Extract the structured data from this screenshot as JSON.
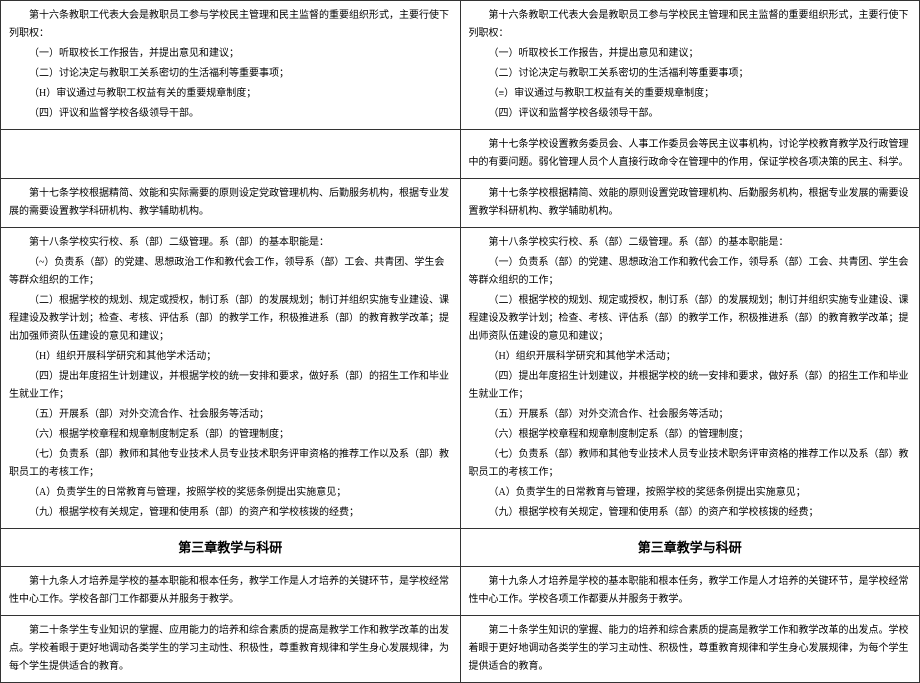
{
  "left": {
    "r1": {
      "p1": "第十六条教职工代表大会是教职员工参与学校民主管理和民主监督的重要组织形式，主要行使下列职权：",
      "p2": "（一）听取校长工作报告，并提出意见和建议；",
      "p3": "（二）讨论决定与教职工关系密切的生活福利等重要事项；",
      "p4": "（H）审议通过与教职工权益有关的重要规章制度；",
      "p5": "（四）评议和监督学校各级领导干部。"
    },
    "r2": "",
    "r3": {
      "p1": "第十七条学校根据精简、效能和实际需要的原则设定党政管理机构、后勤服务机构，根据专业发展的需要设置教学科研机构、教学辅助机构。"
    },
    "r4": {
      "p1": "第十八条学校实行校、系（部）二级管理。系（部）的基本职能是：",
      "p2": "（~）负责系（部）的党建、思想政治工作和教代会工作，领导系（部）工会、共青团、学生会等群众组织的工作；",
      "p3": "（二）根据学校的规划、规定或授权，制订系（部）的发展规划；制订并组织实施专业建设、课程建设及教学计划；检查、考核、评估系（部）的教学工作，积极推进系（部）的教育教学改革；提出加强师资队伍建设的意见和建议；",
      "p4": "（H）组织开展科学研究和其他学术活动；",
      "p5": "（四）提出年度招生计划建议，并根据学校的统一安排和要求，做好系（部）的招生工作和毕业生就业工作；",
      "p6": "（五）开展系（部）对外交流合作、社会服务等活动；",
      "p7": "（六）根据学校章程和规章制度制定系（部）的管理制度；",
      "p8": "（七）负责系（部）教师和其他专业技术人员专业技术职务评审资格的推荐工作以及系（部）教职员工的考核工作；",
      "p9": "（A）负责学生的日常教育与管理，按照学校的奖惩条例提出实施意见；",
      "p10": "（九）根据学校有关规定，管理和使用系（部）的资产和学校核拨的经费；"
    },
    "r5_heading": "第三章教学与科研",
    "r6": {
      "p1": "第十九条人才培养是学校的基本职能和根本任务，教学工作是人才培养的关键环节，是学校经常性中心工作。学校各部门工作都要从并服务于教学。"
    },
    "r7": {
      "p1": "第二十条学生专业知识的掌握、应用能力的培养和综合素质的提高是教学工作和教学改革的出发点。学校着眼于更好地调动各类学生的学习主动性、积极性，尊重教育规律和学生身心发展规律，为每个学生提供适合的教育。"
    }
  },
  "right": {
    "r1": {
      "p1": "第十六条教职工代表大会是教职员工参与学校民主管理和民主监督的重要组织形式，主要行使下列职权：",
      "p2": "（一）听取校长工作报告，并提出意见和建议；",
      "p3": "（二）讨论决定与教职工关系密切的生活福利等重要事项；",
      "p4": "（≡）审议通过与教职工权益有关的重要规章制度；",
      "p5": "（四）评议和监督学校各级领导干部。"
    },
    "r2": {
      "p1": "第十七条学校设置教务委员会、人事工作委员会等民主议事机构，讨论学校教育教学及行政管理中的有要问题。弱化管理人员个人直接行政命令在管理中的作用，保证学校各项决策的民主、科学。"
    },
    "r3": {
      "p1": "第十七条学校根据精简、效能的原则设置党政管理机构、后勤服务机构，根据专业发展的需要设置教学科研机构、教学辅助机构。"
    },
    "r4": {
      "p1": "第十八条学校实行校、系（部）二级管理。系（部）的基本职能是：",
      "p2": "（一）负责系（部）的党建、思想政治工作和教代会工作，领导系（部）工会、共青团、学生会等群众组织的工作；",
      "p3": "（二）根据学校的规划、规定或授权，制订系（部）的发展规划；制订并组织实施专业建设、课程建设及教学计划；检查、考核、评估系（部）的教学工作，积极推进系（部）的教育教学改革；提出师资队伍建设的意见和建议；",
      "p4": "（H）组织开展科学研究和其他学术活动；",
      "p5": "（四）提出年度招生计划建议，并根据学校的统一安排和要求，做好系（部）的招生工作和毕业生就业工作；",
      "p6": "（五）开展系（部）对外交流合作、社会服务等活动；",
      "p7": "（六）根据学校章程和规章制度制定系（部）的管理制度；",
      "p8": "（七）负责系（部）教师和其他专业技术人员专业技术职务评审资格的推荐工作以及系（部）教职员工的考核工作；",
      "p9": "（A）负责学生的日常教育与管理，按照学校的奖惩条例提出实施意见；",
      "p10": "（九）根据学校有关规定，管理和使用系（部）的资产和学校核拨的经费；"
    },
    "r5_heading": "第三章教学与科研",
    "r6": {
      "p1": "第十九条人才培养是学校的基本职能和根本任务，教学工作是人才培养的关键环节，是学校经常性中心工作。学校各项工作都要从并服务于教学。"
    },
    "r7": {
      "p1": "第二十条学生知识的掌握、能力的培养和综合素质的提高是教学工作和教学改革的出发点。学校着眼于更好地调动各类学生的学习主动性、积极性，尊重教育规律和学生身心发展规律，为每个学生提供适合的教育。"
    }
  }
}
